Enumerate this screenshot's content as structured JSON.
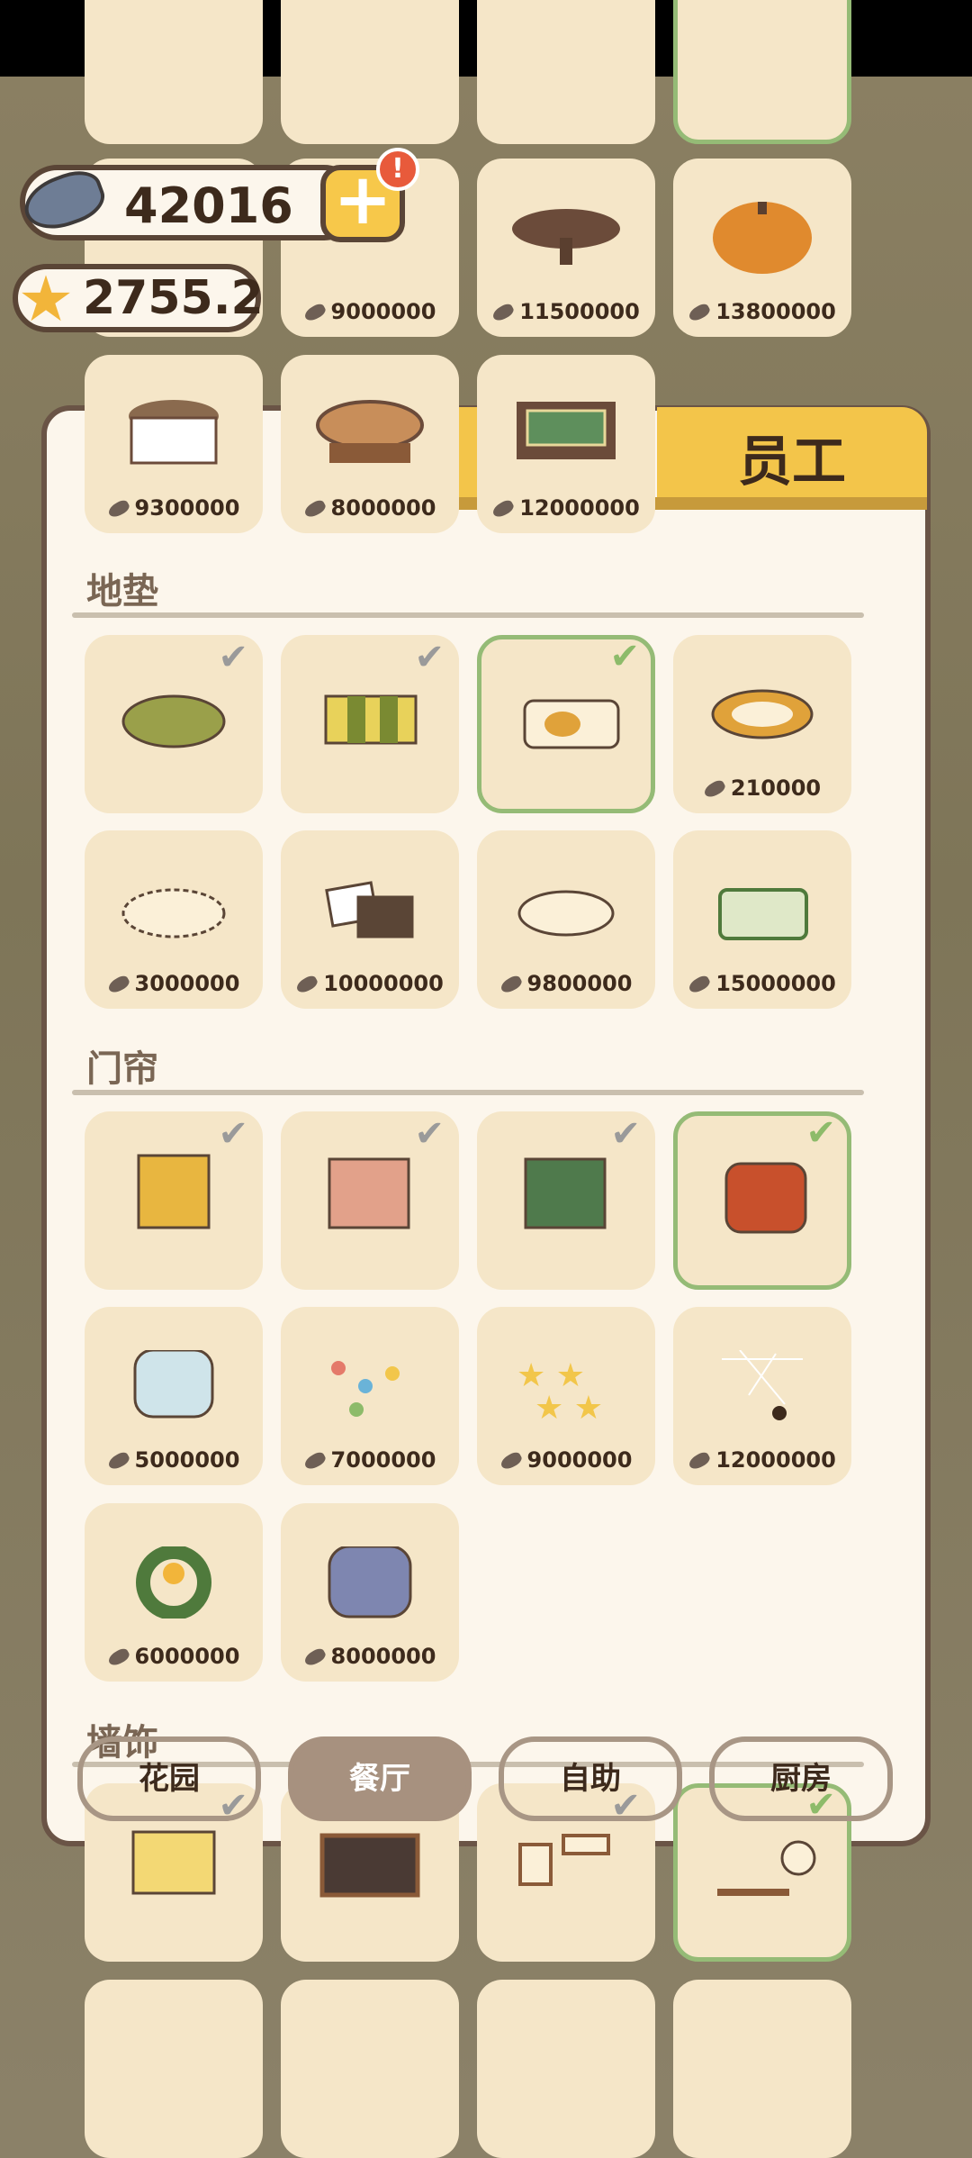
{
  "hud": {
    "fish_count": "42016",
    "star_count": "2755.2",
    "plus_label": "+",
    "alert_label": "!"
  },
  "tabs": {
    "staff_label": "员工"
  },
  "top_cards": [
    {
      "price": "9000000"
    },
    {
      "price": "11500000"
    },
    {
      "price": "13800000"
    },
    {
      "price": "9300000"
    },
    {
      "price": "8000000"
    },
    {
      "price": "12000000"
    }
  ],
  "sections": {
    "mats": {
      "title": "地垫",
      "items": [
        {
          "price": "",
          "owned": true
        },
        {
          "price": "",
          "owned": true
        },
        {
          "price": "",
          "owned": true,
          "selected": true
        },
        {
          "price": "210000"
        },
        {
          "price": "3000000"
        },
        {
          "price": "10000000"
        },
        {
          "price": "9800000"
        },
        {
          "price": "15000000"
        }
      ]
    },
    "curtains": {
      "title": "门帘",
      "items": [
        {
          "price": "",
          "owned": true
        },
        {
          "price": "",
          "owned": true
        },
        {
          "price": "",
          "owned": true
        },
        {
          "price": "",
          "owned": true,
          "selected": true
        },
        {
          "price": "5000000"
        },
        {
          "price": "7000000"
        },
        {
          "price": "9000000"
        },
        {
          "price": "12000000"
        },
        {
          "price": "6000000"
        },
        {
          "price": "8000000"
        }
      ]
    },
    "wall": {
      "title": "墙饰"
    }
  },
  "bottom_nav": [
    {
      "label": "花园"
    },
    {
      "label": "餐厅"
    },
    {
      "label": "自助"
    },
    {
      "label": "厨房"
    }
  ],
  "colors": {
    "accent": "#f3c54a",
    "panel": "#fcf6ec",
    "card": "#f5e6c8",
    "selected": "#95bb76"
  }
}
